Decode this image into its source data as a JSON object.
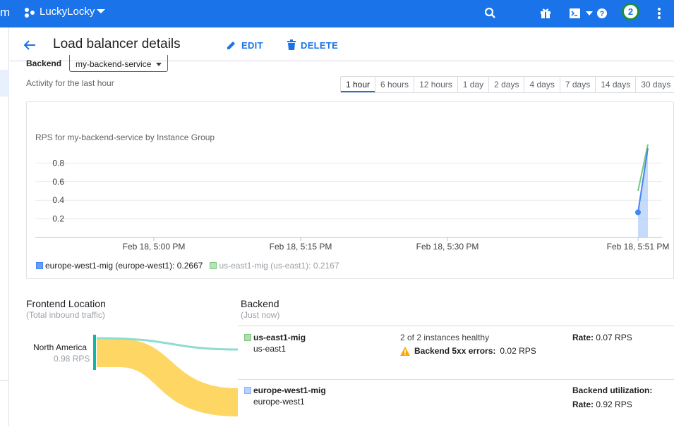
{
  "topbar": {
    "app_fragment": "m",
    "project": "LuckyLocky",
    "notifications": "2",
    "icons": [
      "search-icon",
      "gift-icon",
      "cloud-shell-icon",
      "help-icon",
      "more-vert-icon"
    ]
  },
  "header": {
    "title": "Load balancer details",
    "edit_label": "EDIT",
    "delete_label": "DELETE"
  },
  "backend_selector": {
    "label": "Backend",
    "value": "my-backend-service"
  },
  "activity_label": "Activity for the last hour",
  "time_ranges": [
    "1 hour",
    "6 hours",
    "12 hours",
    "1 day",
    "2 days",
    "4 days",
    "7 days",
    "14 days",
    "30 days"
  ],
  "active_range": "1 hour",
  "chart_data": {
    "type": "line",
    "title": "RPS for my-backend-service by Instance Group",
    "yticks": [
      "0.8",
      "0.6",
      "0.4",
      "0.2"
    ],
    "ylim": [
      0,
      1
    ],
    "xticks": [
      "Feb 18, 5:00 PM",
      "Feb 18, 5:15 PM",
      "Feb 18, 5:30 PM",
      "Feb 18, 5:51 PM"
    ],
    "grid": true,
    "series": [
      {
        "name": "europe-west1-mig (europe-west1)",
        "color": "#4285f4",
        "points": [
          [
            "Feb 18, 5:50 PM",
            0.27
          ],
          [
            "Feb 18, 5:51 PM",
            0.96
          ]
        ]
      },
      {
        "name": "us-east1-mig (us-east1)",
        "color": "#7bc67e",
        "points": [
          [
            "Feb 18, 5:50 PM",
            0.5
          ],
          [
            "Feb 18, 5:51 PM",
            1.0
          ]
        ]
      }
    ],
    "legend": [
      {
        "label": "europe-west1-mig (europe-west1): 0.2667",
        "color": "#4285f4",
        "muted": false
      },
      {
        "label": "us-east1-mig (us-east1): 0.2167",
        "color": "#7bc67e",
        "muted": true
      }
    ]
  },
  "frontend": {
    "title": "Frontend Location",
    "subtitle": "(Total inbound traffic)",
    "location": "North America",
    "rate": "0.98 RPS"
  },
  "backend_panel": {
    "title": "Backend",
    "subtitle": "(Just now)",
    "rows": [
      {
        "name": "us-east1-mig",
        "region": "us-east1",
        "color": "#7bc67e",
        "health": "2 of 2 instances healthy",
        "errors_label": "Backend 5xx errors:",
        "errors_value": "0.02 RPS",
        "rate_label": "Rate:",
        "rate_value": "0.07 RPS"
      },
      {
        "name": "europe-west1-mig",
        "region": "europe-west1",
        "color": "#8ab4f8",
        "util_label": "Backend utilization:",
        "rate_label": "Rate:",
        "rate_value": "0.92 RPS"
      }
    ]
  }
}
